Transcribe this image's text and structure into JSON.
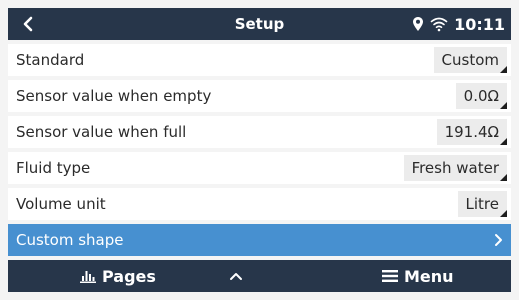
{
  "header": {
    "title": "Setup",
    "time": "10:11",
    "icons": [
      "back-chevron-icon",
      "location-pin-icon",
      "wifi-icon"
    ]
  },
  "settings": [
    {
      "label": "Standard",
      "value": "Custom"
    },
    {
      "label": "Sensor value when empty",
      "value": "0.0Ω"
    },
    {
      "label": "Sensor value when full",
      "value": "191.4Ω"
    },
    {
      "label": "Fluid type",
      "value": "Fresh water"
    },
    {
      "label": "Volume unit",
      "value": "Litre"
    }
  ],
  "submenu": {
    "label": "Custom shape",
    "selected": true
  },
  "footer": {
    "pages_label": "Pages",
    "menu_label": "Menu",
    "icons": [
      "bar-chart-icon",
      "chevron-up-icon",
      "hamburger-menu-icon"
    ]
  },
  "colors": {
    "bar": "#27364a",
    "selected": "#4790d0",
    "row": "#ffffff",
    "background": "#f4f4f4",
    "value_box": "#ececec"
  }
}
